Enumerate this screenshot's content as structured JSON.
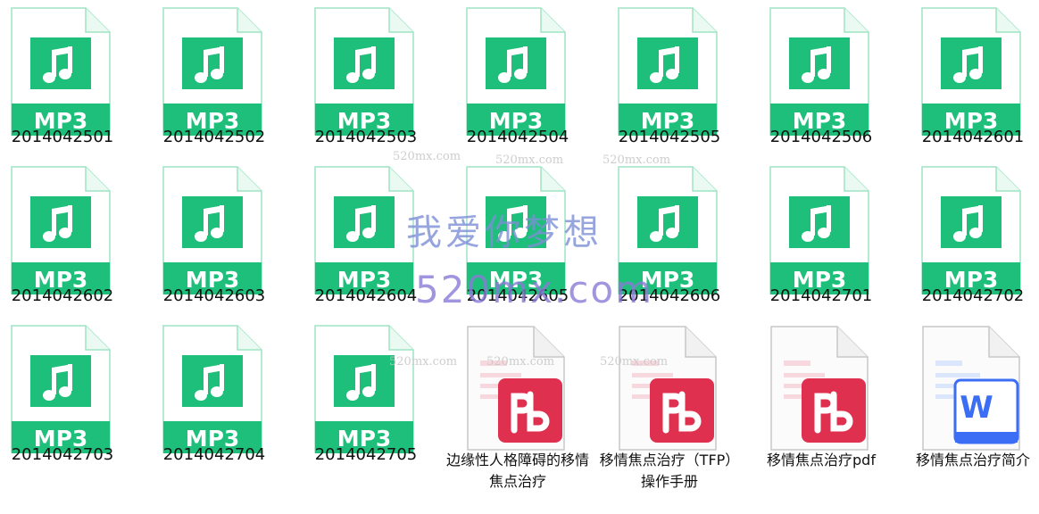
{
  "files": [
    {
      "name": "2014042501",
      "type": "mp3"
    },
    {
      "name": "2014042502",
      "type": "mp3"
    },
    {
      "name": "2014042503",
      "type": "mp3"
    },
    {
      "name": "2014042504",
      "type": "mp3"
    },
    {
      "name": "2014042505",
      "type": "mp3"
    },
    {
      "name": "2014042506",
      "type": "mp3"
    },
    {
      "name": "2014042601",
      "type": "mp3"
    },
    {
      "name": "2014042602",
      "type": "mp3"
    },
    {
      "name": "2014042603",
      "type": "mp3"
    },
    {
      "name": "2014042604",
      "type": "mp3"
    },
    {
      "name": "2014042605",
      "type": "mp3"
    },
    {
      "name": "2014042606",
      "type": "mp3"
    },
    {
      "name": "2014042701",
      "type": "mp3"
    },
    {
      "name": "2014042702",
      "type": "mp3"
    },
    {
      "name": "2014042703",
      "type": "mp3"
    },
    {
      "name": "2014042704",
      "type": "mp3"
    },
    {
      "name": "2014042705",
      "type": "mp3"
    },
    {
      "name": "边缘性人格障碍的移情焦点治疗",
      "type": "pdf"
    },
    {
      "name": "移情焦点治疗（TFP）操作手册",
      "type": "pdf"
    },
    {
      "name": "移情焦点治疗pdf",
      "type": "pdf"
    },
    {
      "name": "移情焦点治疗简介",
      "type": "word"
    }
  ],
  "mp3_badge": "MP3",
  "word_badge": "W",
  "colors": {
    "mp3_green": "#1dbf7a",
    "pdf_red": "#e0304f",
    "word_blue": "#3b6ef5"
  },
  "watermark": {
    "cn": "我爱你梦想",
    "en": "520mx.com",
    "small": "520mx.com"
  }
}
